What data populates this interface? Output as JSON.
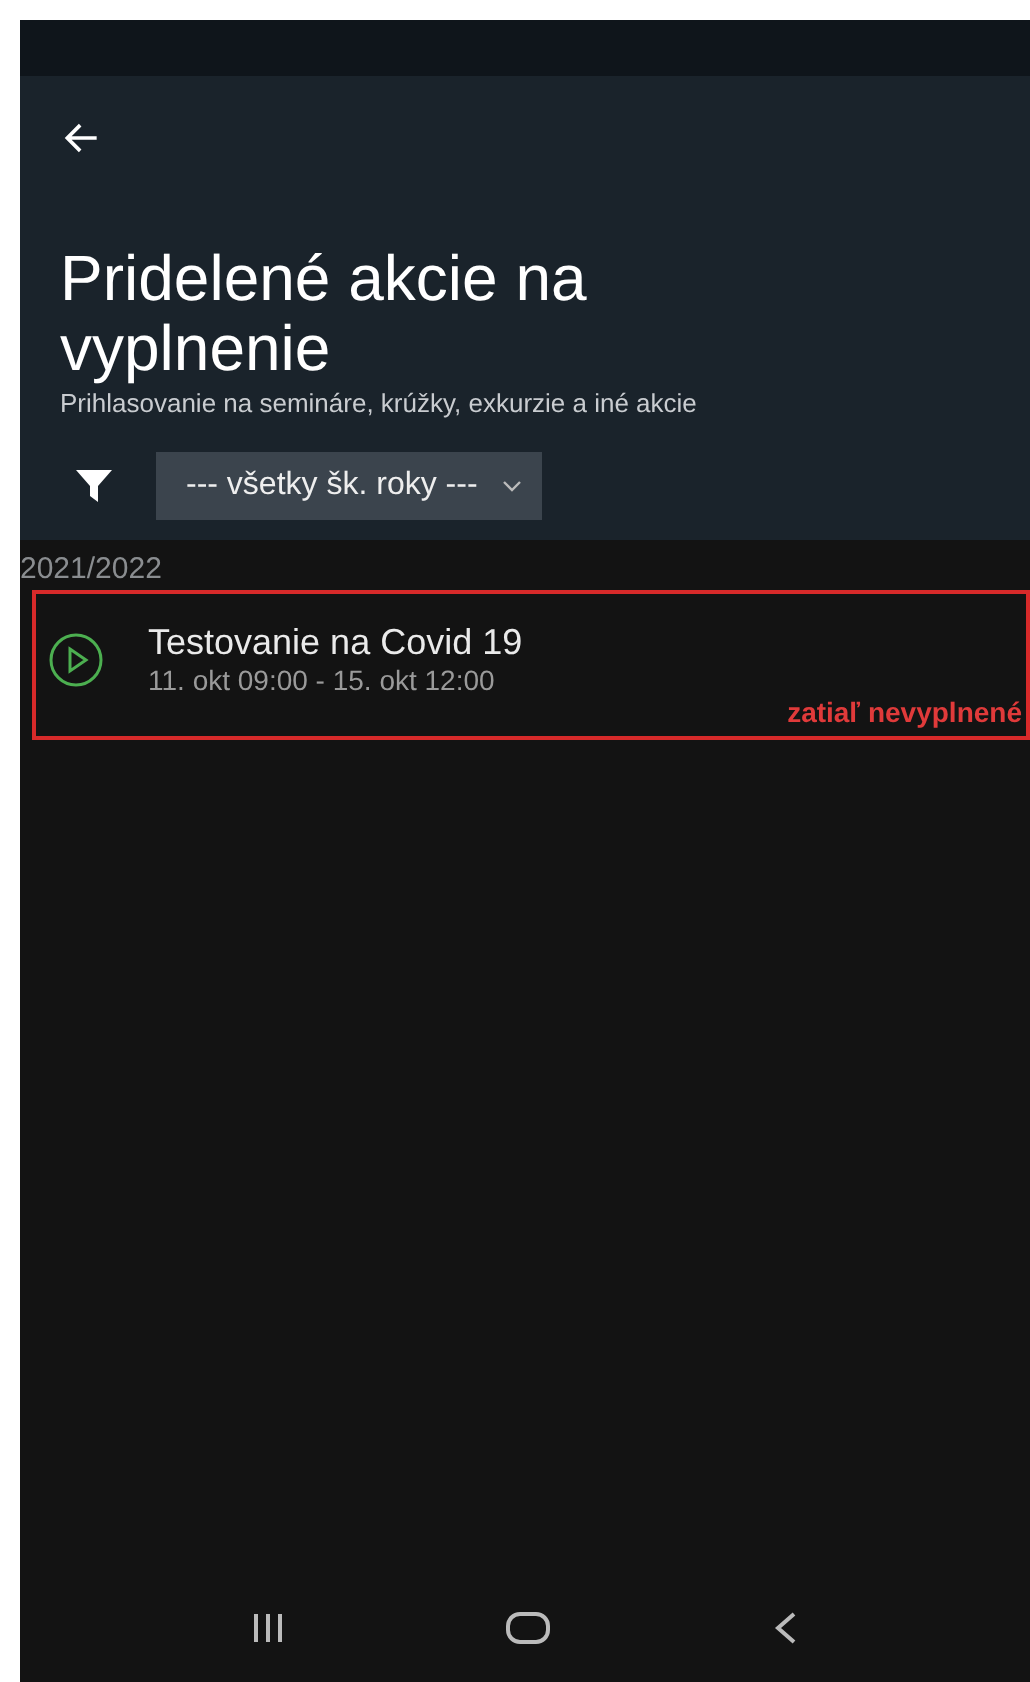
{
  "header": {
    "title": "Pridelené akcie na vyplnenie",
    "subtitle": "Prihlasovanie na semináre, krúžky, exkurzie a iné akcie"
  },
  "filter": {
    "value": "--- všetky šk. roky ---"
  },
  "groups": [
    {
      "label": "2021/2022",
      "events": [
        {
          "title": "Testovanie na Covid 19",
          "dates": "11. okt 09:00 - 15. okt 12:00",
          "status": "zatiaľ nevyplnené",
          "highlighted": true,
          "color": "#4caf50"
        }
      ]
    }
  ]
}
